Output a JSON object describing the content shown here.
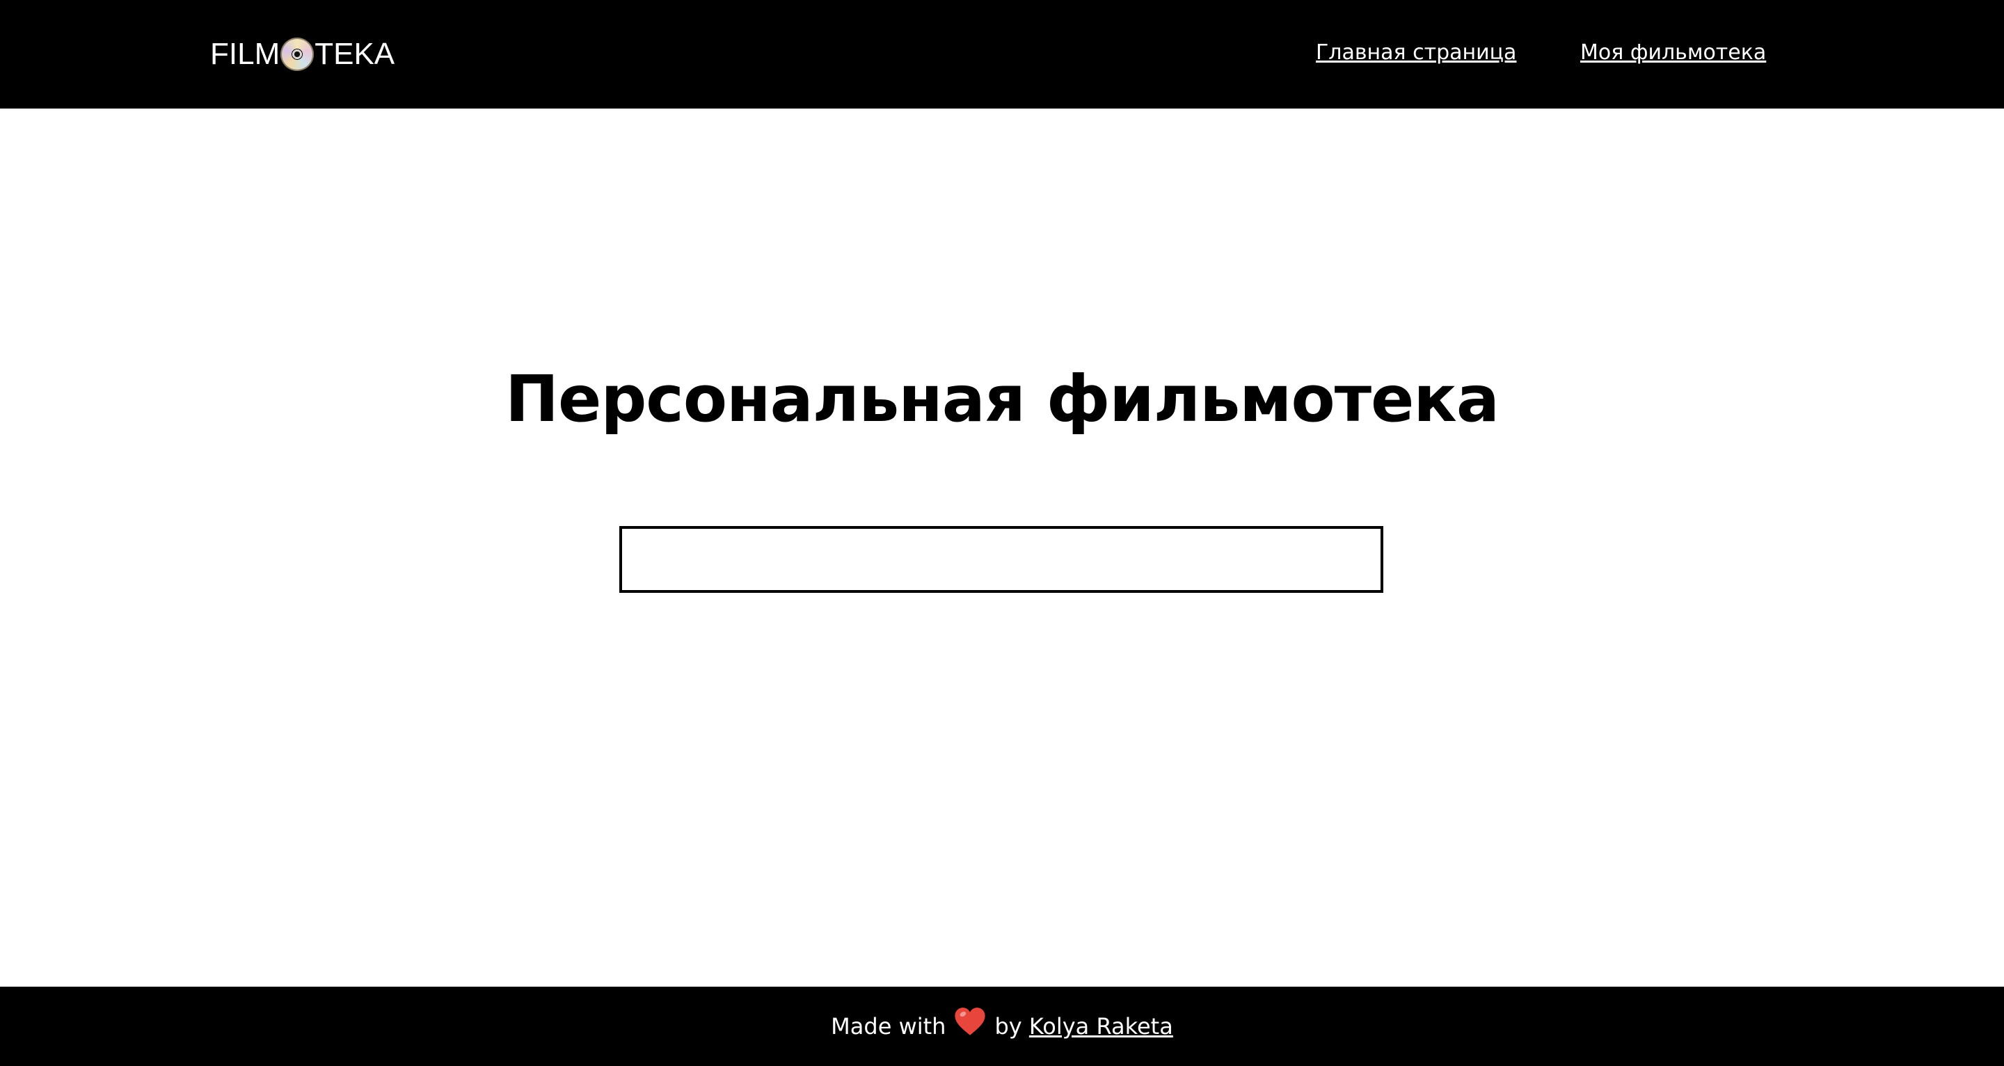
{
  "header": {
    "logo": {
      "text_before": "FILM",
      "icon": "dvd-disc-icon",
      "text_after": "TEKA"
    },
    "nav": [
      {
        "label": "Главная страница"
      },
      {
        "label": "Моя фильмотека"
      }
    ],
    "background_color": "#000000"
  },
  "main": {
    "title": "Персональная фильмотека",
    "search": {
      "value": "",
      "placeholder": ""
    }
  },
  "footer": {
    "text_made_with": "Made with",
    "icon": "heart-icon",
    "text_by": "by",
    "author_link": "Kolya Raketa",
    "heart_color": "#e8453c"
  }
}
